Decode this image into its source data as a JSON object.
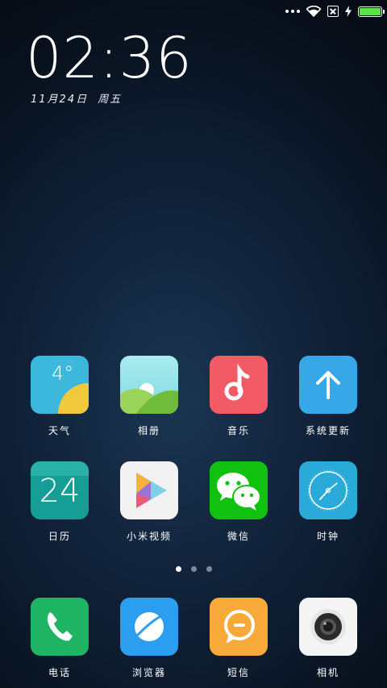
{
  "status_bar": {
    "icons": [
      "more-dots-icon",
      "wifi-icon",
      "no-sim-icon",
      "charging-bolt-icon",
      "battery-icon"
    ],
    "battery_level": 1.0
  },
  "clock": {
    "time": "02:36"
  },
  "date": {
    "day": "11月24日",
    "weekday": "周五"
  },
  "apps": [
    {
      "id": "weather",
      "label": "天气",
      "icon": "weather-icon",
      "value": "4°"
    },
    {
      "id": "gallery",
      "label": "相册",
      "icon": "gallery-icon"
    },
    {
      "id": "music",
      "label": "音乐",
      "icon": "music-note-icon"
    },
    {
      "id": "updater",
      "label": "系统更新",
      "icon": "up-arrow-icon"
    },
    {
      "id": "calendar",
      "label": "日历",
      "icon": "calendar-icon",
      "value": "24"
    },
    {
      "id": "video",
      "label": "小米视频",
      "icon": "play-icon"
    },
    {
      "id": "wechat",
      "label": "微信",
      "icon": "wechat-icon"
    },
    {
      "id": "clock",
      "label": "时钟",
      "icon": "clock-icon"
    }
  ],
  "pager": {
    "count": 3,
    "active": 0
  },
  "dock": [
    {
      "id": "phone",
      "label": "电话",
      "icon": "phone-icon"
    },
    {
      "id": "browser",
      "label": "浏览器",
      "icon": "browser-icon"
    },
    {
      "id": "messages",
      "label": "短信",
      "icon": "message-icon"
    },
    {
      "id": "camera",
      "label": "相机",
      "icon": "camera-icon"
    }
  ],
  "colors": {
    "weather_bg": "#3cb8dc",
    "weather_sun": "#f2c83c",
    "gallery_sky": "#8fe0e6",
    "gallery_hill": "#7cc447",
    "music_bg": "#f25a66",
    "updater_bg": "#37a7e8",
    "calendar_bg": "#169e96",
    "video_bg": "#f2f2f2",
    "wechat_bg": "#10c110",
    "clock_bg": "#2aaad8",
    "phone_bg": "#1fb463",
    "browser_bg": "#2c9ef0",
    "messages_bg": "#f7a93a",
    "camera_bg": "#f4f4f4"
  }
}
